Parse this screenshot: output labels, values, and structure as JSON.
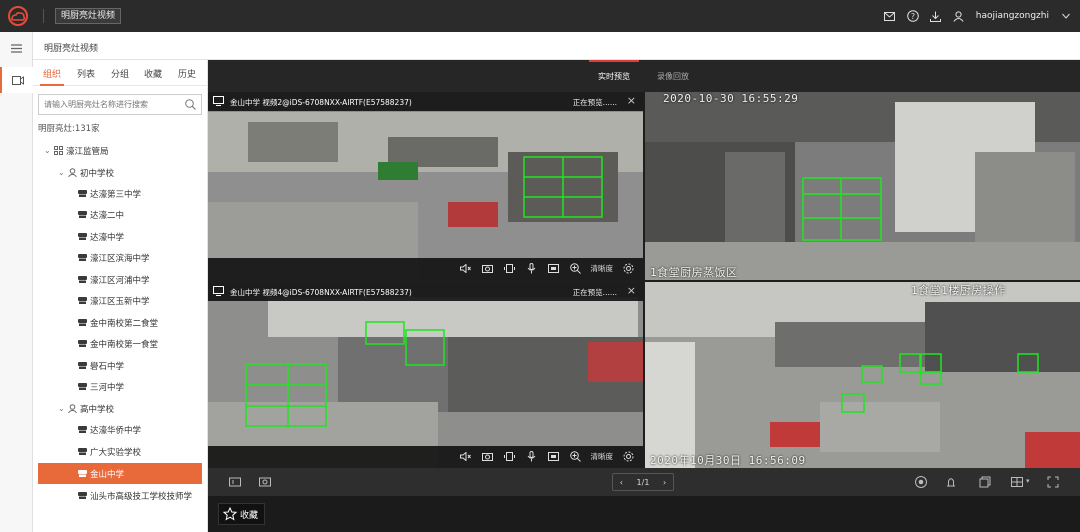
{
  "header": {
    "app_title": "明厨亮灶视频",
    "username": "haojiangzongzhi",
    "icons": [
      "mail-icon",
      "help-icon",
      "download-icon",
      "user-icon",
      "chevron-down-icon"
    ]
  },
  "breadcrumb": "明厨亮灶视频",
  "panel": {
    "tabs": [
      "组织",
      "列表",
      "分组",
      "收藏",
      "历史"
    ],
    "search_placeholder": "请输入明厨亮灶名称进行搜索",
    "count_label": "明厨亮灶:131家",
    "tree": {
      "root": "濠江监管局",
      "groups": [
        {
          "name": "初中学校",
          "schools": [
            "达濠第三中学",
            "达濠二中",
            "达濠中学",
            "濠江区滨海中学",
            "濠江区河浦中学",
            "濠江区玉新中学",
            "金中南校第二食堂",
            "金中南校第一食堂",
            "礐石中学",
            "三河中学"
          ]
        },
        {
          "name": "高中学校",
          "schools": [
            "达濠华侨中学",
            "广大实验学校",
            "金山中学",
            "汕头市高级技工学校技师学"
          ]
        }
      ],
      "selected": "金山中学"
    }
  },
  "main": {
    "modes": [
      "实时预览",
      "录像回放"
    ],
    "active_mode": "实时预览",
    "tiles": [
      {
        "title": "金山中学 视频2@iDS-6708NXX-AIRTF(E57588237)",
        "status": "正在预览......",
        "quality": "清晰度"
      },
      {
        "osd_top": "2020-10-30 16:55:29",
        "osd_bottom": "1食堂厨房蒸饭区"
      },
      {
        "title": "金山中学 视频4@iDS-6708NXX-AIRTF(E57588237)",
        "status": "正在预览......",
        "quality": "清晰度"
      },
      {
        "osd_top": "1食堂1楼厨房操作",
        "osd_bottom": "2020年10月30日  16:56:09"
      }
    ],
    "pager": "1/1",
    "favorite_label": "收藏"
  }
}
